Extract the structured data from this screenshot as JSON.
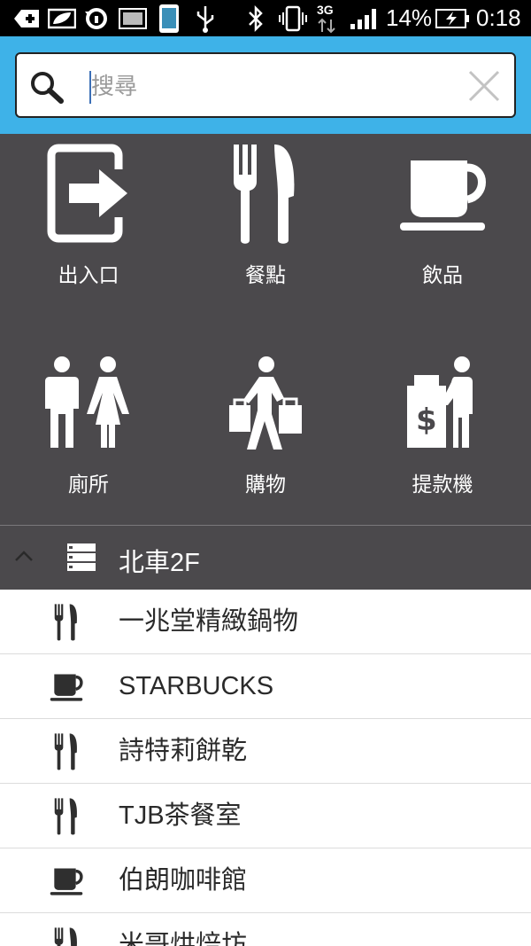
{
  "status_bar": {
    "battery_percent": "14%",
    "time": "0:18",
    "network": "3G"
  },
  "search": {
    "placeholder": "搜尋",
    "value": ""
  },
  "categories": [
    {
      "label": "出入口",
      "icon": "exit-icon"
    },
    {
      "label": "餐點",
      "icon": "fork-knife-icon"
    },
    {
      "label": "飲品",
      "icon": "coffee-cup-icon"
    },
    {
      "label": "廁所",
      "icon": "restroom-icon"
    },
    {
      "label": "購物",
      "icon": "shopping-icon"
    },
    {
      "label": "提款機",
      "icon": "atm-icon"
    }
  ],
  "floor_section": {
    "title": "北車2F"
  },
  "places": [
    {
      "name": "一兆堂精緻鍋物",
      "icon": "fork-knife-icon"
    },
    {
      "name": "STARBUCKS",
      "icon": "coffee-cup-icon"
    },
    {
      "name": "詩特莉餅乾",
      "icon": "fork-knife-icon"
    },
    {
      "name": "TJB茶餐室",
      "icon": "fork-knife-icon"
    },
    {
      "name": "伯朗咖啡館",
      "icon": "coffee-cup-icon"
    },
    {
      "name": "米哥烘焙坊",
      "icon": "fork-knife-icon"
    }
  ]
}
